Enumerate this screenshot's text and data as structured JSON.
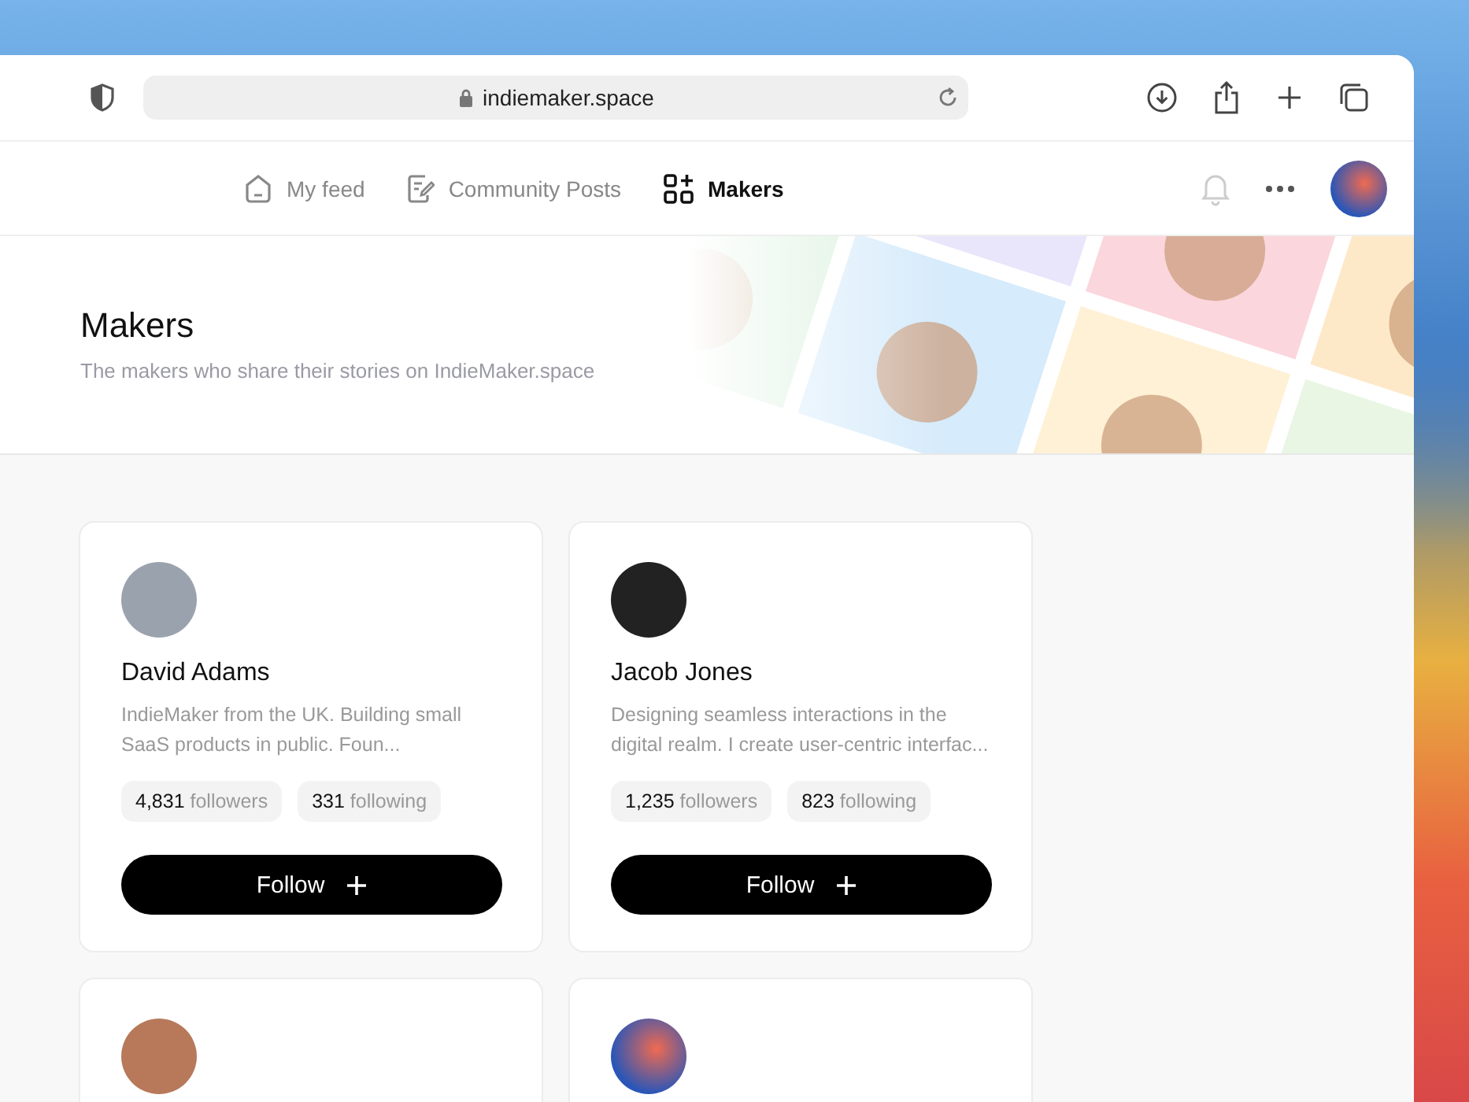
{
  "browser": {
    "url": "indiemaker.space"
  },
  "nav": {
    "tabs": [
      {
        "label": "My feed",
        "kind": "home",
        "selected": false
      },
      {
        "label": "Community Posts",
        "kind": "posts",
        "selected": false
      },
      {
        "label": "Makers",
        "kind": "grid",
        "selected": true
      }
    ]
  },
  "header": {
    "title": "Makers",
    "subtitle": "The makers who share their stories on IndieMaker.space"
  },
  "makers": [
    {
      "kind": "full",
      "name": "David Adams",
      "bio": "IndieMaker from the UK. Building small SaaS products in public. Foun...",
      "followers": "4,831",
      "followers_label": "followers",
      "following": "331",
      "following_label": "following",
      "button": "Follow"
    },
    {
      "kind": "full",
      "name": "Jacob Jones",
      "bio": "Designing seamless interactions in the digital realm. I create user-centric interfac...",
      "followers": "1,235",
      "followers_label": "followers",
      "following": "823",
      "following_label": "following",
      "button": "Follow"
    },
    {
      "kind": "avatar_only"
    },
    {
      "kind": "avatar_only"
    }
  ]
}
